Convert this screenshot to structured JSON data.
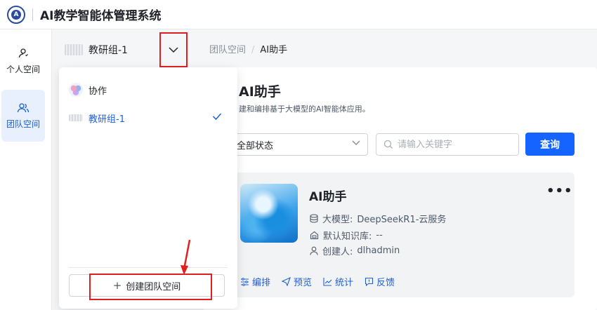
{
  "header": {
    "title": "AI教学智能体管理系统",
    "logo_icon": "university-seal"
  },
  "rail": {
    "items": [
      {
        "label": "个人空间",
        "icon": "user-icon",
        "active": false
      },
      {
        "label": "团队空间",
        "icon": "team-icon",
        "active": true
      }
    ]
  },
  "workspace_selector": {
    "current": "教研组-1"
  },
  "dropdown": {
    "items": [
      {
        "label": "协作",
        "selected": false
      },
      {
        "label": "教研组-1",
        "selected": true
      }
    ],
    "create_label": "创建团队空间"
  },
  "breadcrumb": {
    "root": "团队空间",
    "current": "AI助手"
  },
  "page": {
    "title": "AI助手",
    "subtitle": "建和编排基于大模型的AI智能体应用。"
  },
  "filters": {
    "status_value": "全部状态",
    "search_placeholder": "请输入关键字",
    "query_label": "查询"
  },
  "card": {
    "title": "AI助手",
    "more": "•••",
    "model_key": "大模型:",
    "model_value": "DeepSeekR1-云服务",
    "kb_key": "默认知识库:",
    "kb_value": "--",
    "creator_key": "创建人:",
    "creator_value": "dlhadmin",
    "actions": [
      "编排",
      "预览",
      "统计",
      "反馈"
    ]
  },
  "colors": {
    "primary": "#1664ff",
    "annotation": "#e02020"
  }
}
